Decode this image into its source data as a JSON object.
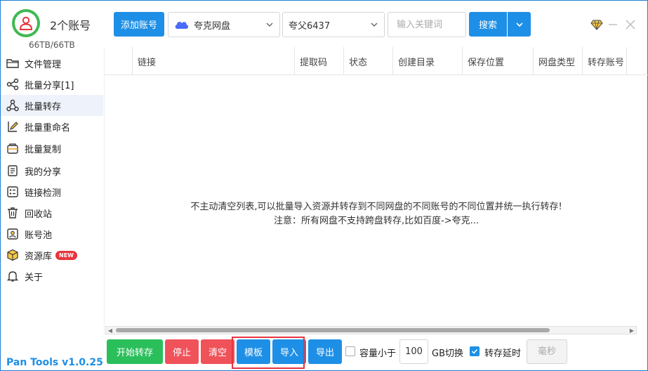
{
  "header": {
    "account_count": "2个账号",
    "storage": "66TB/66TB",
    "add_account": "添加账号",
    "drive_select": "夸克网盘",
    "account_select": "夸父6437",
    "search_placeholder": "输入关键词",
    "search_button": "搜索"
  },
  "sidebar": {
    "items": [
      {
        "label": "文件管理",
        "icon": "folder-icon"
      },
      {
        "label": "批量分享[1]",
        "icon": "share-icon"
      },
      {
        "label": "批量转存",
        "icon": "transfer-icon"
      },
      {
        "label": "批量重命名",
        "icon": "rename-icon"
      },
      {
        "label": "批量复制",
        "icon": "copy-icon"
      },
      {
        "label": "我的分享",
        "icon": "my-share-icon"
      },
      {
        "label": "链接检测",
        "icon": "link-check-icon"
      },
      {
        "label": "回收站",
        "icon": "trash-icon"
      },
      {
        "label": "账号池",
        "icon": "account-pool-icon"
      },
      {
        "label": "资源库",
        "icon": "resource-icon",
        "badge": "NEW"
      },
      {
        "label": "关于",
        "icon": "bell-icon"
      }
    ],
    "version": "Pan Tools v1.0.25"
  },
  "table": {
    "columns": [
      "链接",
      "提取码",
      "状态",
      "创建目录",
      "保存位置",
      "网盘类型",
      "转存账号"
    ],
    "empty_line1": "不主动清空列表,可以批量导入资源并转存到不同网盘的不同账号的不同位置并统一执行转存!",
    "empty_line2": "注意：所有网盘不支持跨盘转存,比如百度->夸克..."
  },
  "toolbar": {
    "start": "开始转存",
    "stop": "停止",
    "clear": "清空",
    "template": "模板",
    "import": "导入",
    "export": "导出",
    "capacity_label": "容量小于",
    "capacity_value": "100",
    "gb_switch": "GB切换",
    "delay_label": "转存延时",
    "ms_placeholder": "毫秒"
  },
  "colors": {
    "accent": "#1e8fe6",
    "green": "#2bbf5b",
    "red": "#f0525a",
    "highlight": "#e8343c"
  }
}
